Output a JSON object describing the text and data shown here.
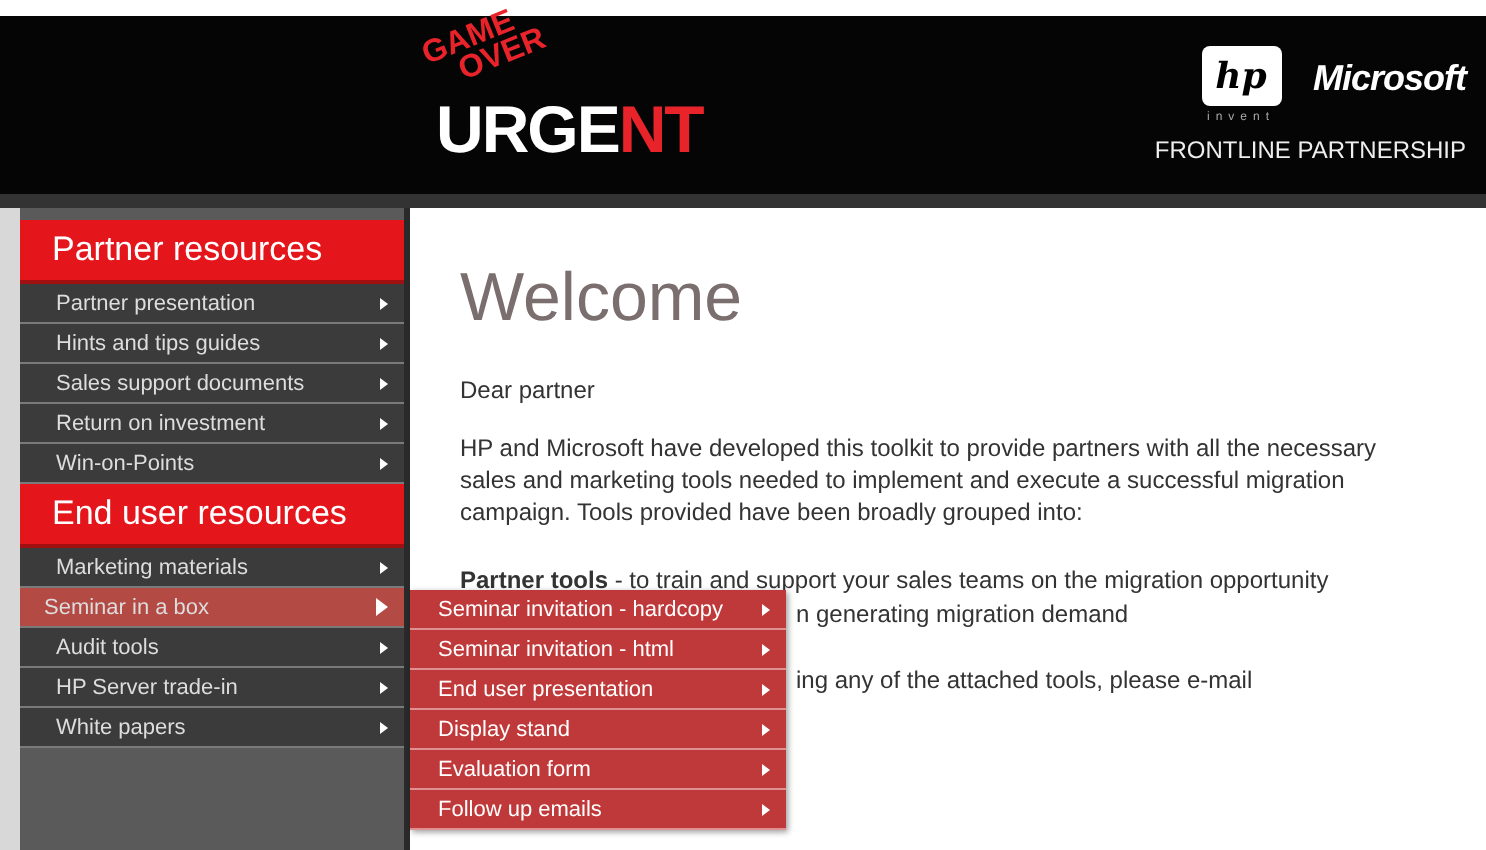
{
  "header": {
    "logo": {
      "stamp": [
        "GAME",
        "OVER"
      ],
      "word_start": "URGE",
      "word_end": "NT"
    },
    "hp_logo": {
      "mark": "hp",
      "tagline": "invent"
    },
    "partner_logo": "Microsoft",
    "partnership": "FRONTLINE PARTNERSHIP"
  },
  "sidebar": {
    "sections": [
      {
        "heading": "Partner resources",
        "items": [
          {
            "label": "Partner presentation",
            "selected": false
          },
          {
            "label": "Hints and tips guides",
            "selected": false
          },
          {
            "label": "Sales support documents",
            "selected": false
          },
          {
            "label": "Return on investment",
            "selected": false
          },
          {
            "label": "Win-on-Points",
            "selected": false
          }
        ]
      },
      {
        "heading": "End user resources",
        "items": [
          {
            "label": "Marketing materials",
            "selected": false
          },
          {
            "label": "Seminar in a box",
            "selected": true
          },
          {
            "label": "Audit tools",
            "selected": false
          },
          {
            "label": "HP Server trade-in",
            "selected": false
          },
          {
            "label": "White papers",
            "selected": false
          }
        ]
      }
    ]
  },
  "submenu": {
    "items": [
      {
        "label": "Seminar invitation - hardcopy"
      },
      {
        "label": "Seminar invitation - html"
      },
      {
        "label": "End user presentation"
      },
      {
        "label": "Display stand"
      },
      {
        "label": "Evaluation form"
      },
      {
        "label": "Follow up emails"
      }
    ]
  },
  "content": {
    "title": "Welcome",
    "greeting": "Dear partner",
    "intro": "HP and Microsoft have developed this toolkit to provide partners with all the necessary sales and marketing tools needed to implement and execute a successful migration campaign. Tools provided have been broadly grouped into:",
    "visible_lines": [
      "**Partner tools** - to train and support your sales teams on the migration opportunity",
      "n generating migration demand",
      "ing any of the attached tools, please e-mail"
    ]
  }
}
